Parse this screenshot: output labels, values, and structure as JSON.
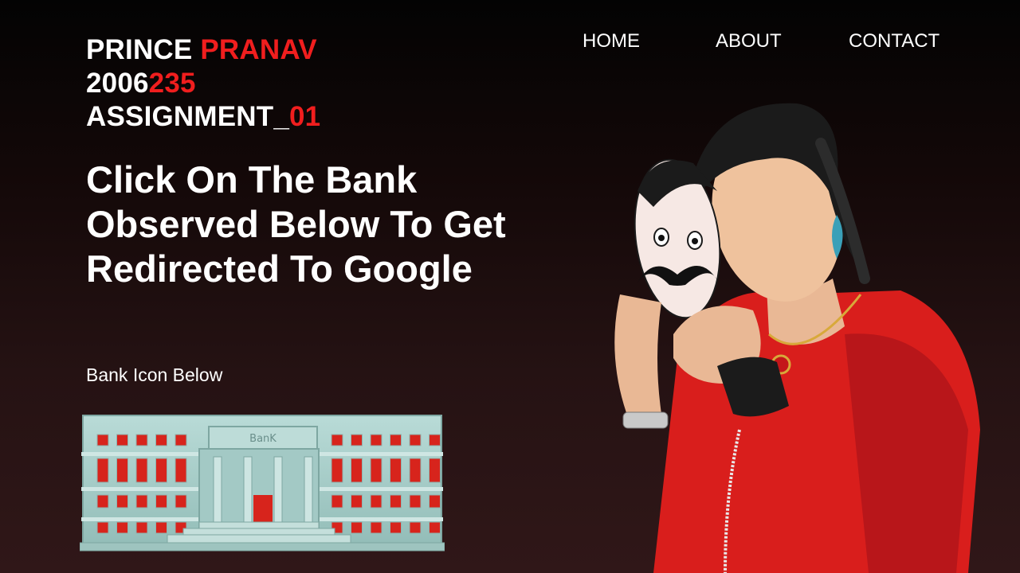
{
  "header": {
    "name_first": "PRINCE ",
    "name_last": "PRANAV",
    "id_prefix": "2006",
    "id_suffix": "235",
    "assignment_prefix": "ASSIGNMENT_",
    "assignment_suffix": "01"
  },
  "nav": {
    "home": "HOME",
    "about": "ABOUT",
    "contact": "CONTACT"
  },
  "main": {
    "headline": "Click On The Bank Observed Below To Get Redirected To Google",
    "bank_label": "Bank Icon Below",
    "bank_sign": "BanK"
  },
  "colors": {
    "accent": "#f01e1e",
    "building": "#a9cfcb",
    "hoodie": "#e0201e"
  }
}
